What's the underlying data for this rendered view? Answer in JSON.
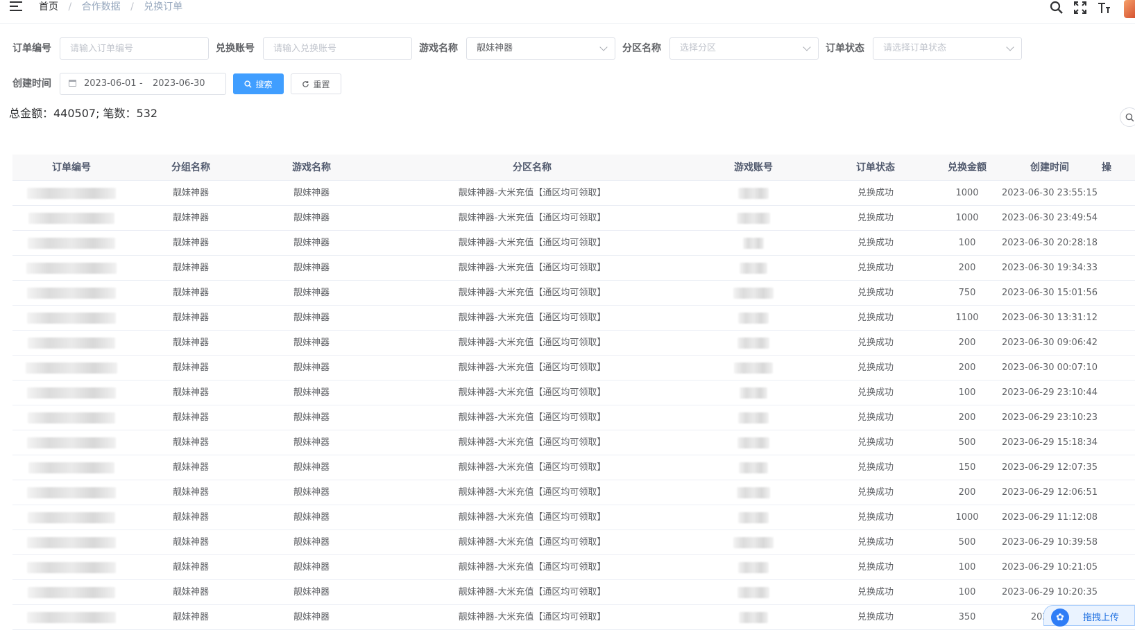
{
  "header": {
    "breadcrumb": [
      "首页",
      "合作数据",
      "兑换订单"
    ],
    "separator": "/"
  },
  "filters": {
    "order_no": {
      "label": "订单编号",
      "placeholder": "请输入订单编号"
    },
    "account": {
      "label": "兑换账号",
      "placeholder": "请输入兑换账号"
    },
    "game": {
      "label": "游戏名称",
      "value": "靓妹神器"
    },
    "zone": {
      "label": "分区名称",
      "placeholder": "选择分区"
    },
    "status": {
      "label": "订单状态",
      "placeholder": "请选择订单状态"
    },
    "created": {
      "label": "创建时间",
      "start": "2023-06-01",
      "separator": "-",
      "end": "2023-06-30"
    },
    "search_label": "搜索",
    "reset_label": "重置"
  },
  "summary": {
    "text": "总金额：440507; 笔数：532"
  },
  "table": {
    "columns": [
      "订单编号",
      "分组名称",
      "游戏名称",
      "分区名称",
      "游戏账号",
      "订单状态",
      "兑换金额",
      "创建时间",
      "操"
    ],
    "rows": [
      [
        "靓妹神器",
        "靓妹神器",
        "靓妹神器-大米充值【通区均可领取】",
        "兑换成功",
        "1000",
        "2023-06-30 23:55:15"
      ],
      [
        "靓妹神器",
        "靓妹神器",
        "靓妹神器-大米充值【通区均可领取】",
        "兑换成功",
        "1000",
        "2023-06-30 23:49:54"
      ],
      [
        "靓妹神器",
        "靓妹神器",
        "靓妹神器-大米充值【通区均可领取】",
        "兑换成功",
        "100",
        "2023-06-30 20:28:18"
      ],
      [
        "靓妹神器",
        "靓妹神器",
        "靓妹神器-大米充值【通区均可领取】",
        "兑换成功",
        "200",
        "2023-06-30 19:34:33"
      ],
      [
        "靓妹神器",
        "靓妹神器",
        "靓妹神器-大米充值【通区均可领取】",
        "兑换成功",
        "750",
        "2023-06-30 15:01:56"
      ],
      [
        "靓妹神器",
        "靓妹神器",
        "靓妹神器-大米充值【通区均可领取】",
        "兑换成功",
        "1100",
        "2023-06-30 13:31:12"
      ],
      [
        "靓妹神器",
        "靓妹神器",
        "靓妹神器-大米充值【通区均可领取】",
        "兑换成功",
        "200",
        "2023-06-30 09:06:42"
      ],
      [
        "靓妹神器",
        "靓妹神器",
        "靓妹神器-大米充值【通区均可领取】",
        "兑换成功",
        "200",
        "2023-06-30 00:07:10"
      ],
      [
        "靓妹神器",
        "靓妹神器",
        "靓妹神器-大米充值【通区均可领取】",
        "兑换成功",
        "100",
        "2023-06-29 23:10:44"
      ],
      [
        "靓妹神器",
        "靓妹神器",
        "靓妹神器-大米充值【通区均可领取】",
        "兑换成功",
        "200",
        "2023-06-29 23:10:23"
      ],
      [
        "靓妹神器",
        "靓妹神器",
        "靓妹神器-大米充值【通区均可领取】",
        "兑换成功",
        "500",
        "2023-06-29 15:18:34"
      ],
      [
        "靓妹神器",
        "靓妹神器",
        "靓妹神器-大米充值【通区均可领取】",
        "兑换成功",
        "150",
        "2023-06-29 12:07:35"
      ],
      [
        "靓妹神器",
        "靓妹神器",
        "靓妹神器-大米充值【通区均可领取】",
        "兑换成功",
        "200",
        "2023-06-29 12:06:51"
      ],
      [
        "靓妹神器",
        "靓妹神器",
        "靓妹神器-大米充值【通区均可领取】",
        "兑换成功",
        "1000",
        "2023-06-29 11:12:08"
      ],
      [
        "靓妹神器",
        "靓妹神器",
        "靓妹神器-大米充值【通区均可领取】",
        "兑换成功",
        "500",
        "2023-06-29 10:39:58"
      ],
      [
        "靓妹神器",
        "靓妹神器",
        "靓妹神器-大米充值【通区均可领取】",
        "兑换成功",
        "100",
        "2023-06-29 10:21:05"
      ],
      [
        "靓妹神器",
        "靓妹神器",
        "靓妹神器-大米充值【通区均可领取】",
        "兑换成功",
        "100",
        "2023-06-29 10:20:35"
      ],
      [
        "靓妹神器",
        "靓妹神器",
        "靓妹神器-大米充值【通区均可领取】",
        "兑换成功",
        "350",
        "2023-06"
      ]
    ]
  },
  "upload_widget": {
    "label": "拖拽上传"
  },
  "icons": {
    "menu": "hamburger-icon",
    "search": "search-icon",
    "fullscreen": "fullscreen-icon",
    "font_size": "font-size-icon",
    "calendar": "calendar-icon",
    "refresh": "refresh-icon",
    "upload": "cloud-upload-icon"
  },
  "colors": {
    "primary": "#409eff",
    "header_bg": "#f8f8f9",
    "border": "#dcdfe6",
    "breadcrumb_inactive": "#97a8be"
  }
}
